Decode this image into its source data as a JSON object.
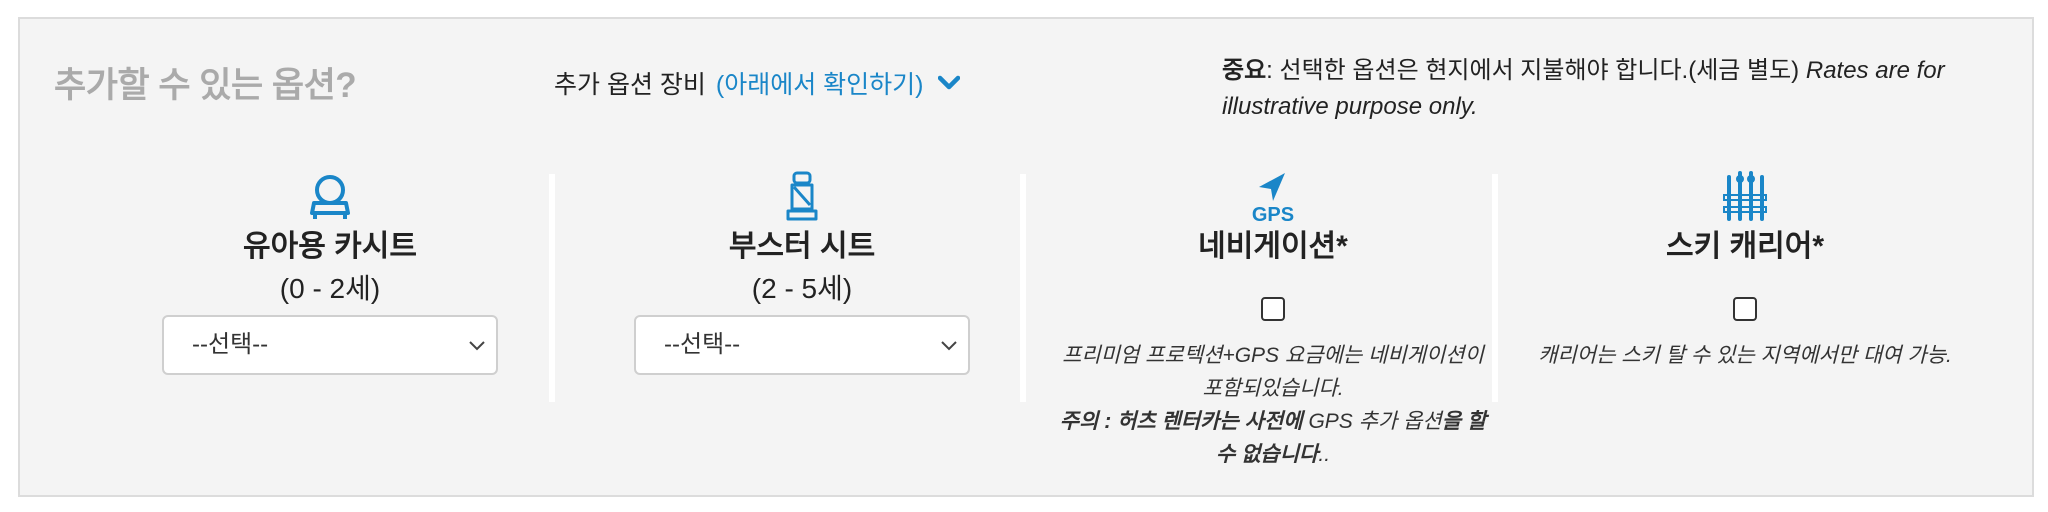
{
  "header": {
    "title": "추가할 수 있는 옵션?",
    "equipment_label": "추가 옵션 장비",
    "equipment_link": "(아래에서 확인하기)",
    "notice_bold": "중요",
    "notice_text": ": 선택한 옵션은 현지에서 지불해야 합니다.(세금 별도) ",
    "notice_italic": "Rates are for illustrative purpose only."
  },
  "options": [
    {
      "name": "유아용 카시트",
      "age": "(0 - 2세)",
      "select_value": "--선택--",
      "icon": "infant-seat-icon"
    },
    {
      "name": "부스터 시트",
      "age": "(2 - 5세)",
      "select_value": "--선택--",
      "icon": "booster-seat-icon"
    },
    {
      "name": "네비게이션*",
      "icon": "gps-icon",
      "icon_text": "GPS",
      "desc_line": "프리미엄 프로텍션+GPS 요금에는 네비게이션이 포함되있습니다.",
      "note_bold_1": "주의 :  허츠 렌터카는 사전에 ",
      "note_italic": "GPS 추가 옵션",
      "note_bold_2": "을 할 수 없습니다",
      "note_end": ".."
    },
    {
      "name": "스키 캐리어*",
      "icon": "ski-rack-icon",
      "desc_line": "캐리어는 스키 탈 수 있는 지역에서만 대여 가능."
    }
  ],
  "colors": {
    "accent": "#1a86c8",
    "title_gray": "#aaaaaa",
    "panel_bg": "#f4f4f4"
  }
}
